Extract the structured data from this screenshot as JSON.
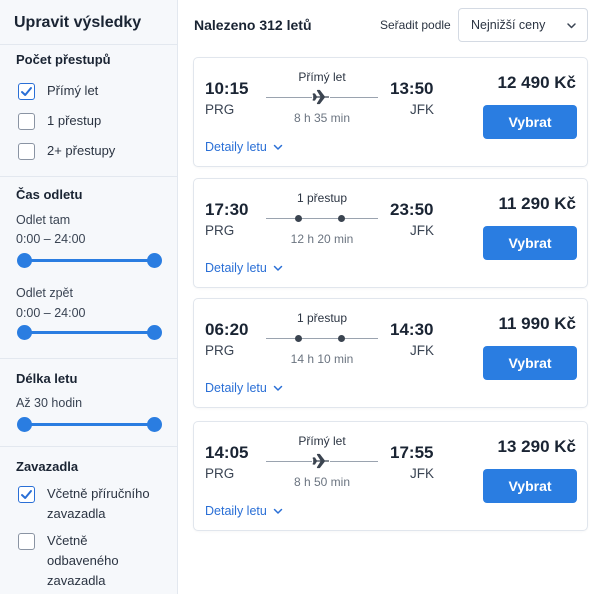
{
  "sidebar": {
    "title": "Upravit výsledky",
    "stops": {
      "heading": "Počet přestupů",
      "options": [
        {
          "label": "Přímý let",
          "checked": true
        },
        {
          "label": "1 přestup",
          "checked": false
        },
        {
          "label": "2+ přestupy",
          "checked": false
        }
      ]
    },
    "departure": {
      "heading": "Čas odletu",
      "outbound_label": "Odlet tam",
      "outbound_range": "0:00 – 24:00",
      "return_label": "Odlet zpět",
      "return_range": "0:00 – 24:00"
    },
    "duration": {
      "heading": "Délka letu",
      "value": "Až 30 hodin"
    },
    "baggage": {
      "heading": "Zavazadla",
      "options": [
        {
          "label": "Včetně příručního zavazadla",
          "checked": true
        },
        {
          "label": "Včetně odbaveného zavazadla",
          "checked": false
        }
      ]
    }
  },
  "header": {
    "results": "Nalezeno 312 letů",
    "sort_label": "Seřadit podle",
    "sort_value": "Nejnižší ceny"
  },
  "flights": [
    {
      "dep_time": "10:15",
      "dep_code": "PRG",
      "arr_time": "13:50",
      "arr_code": "JFK",
      "stops": "Přímý let",
      "duration": "8 h 35 min",
      "price": "12 490 Kč",
      "select": "Vybrat",
      "details": "Detaily letu",
      "direct": true
    },
    {
      "dep_time": "17:30",
      "dep_code": "PRG",
      "arr_time": "23:50",
      "arr_code": "JFK",
      "stops": "1 přestup",
      "duration": "12 h 20 min",
      "price": "11 290 Kč",
      "select": "Vybrat",
      "details": "Detaily letu",
      "direct": false
    },
    {
      "dep_time": "06:20",
      "dep_code": "PRG",
      "arr_time": "14:30",
      "arr_code": "JFK",
      "stops": "1 přestup",
      "duration": "14 h 10 min",
      "price": "11 990 Kč",
      "select": "Vybrat",
      "details": "Detaily letu",
      "direct": false
    },
    {
      "dep_time": "14:05",
      "dep_code": "PRG",
      "arr_time": "17:55",
      "arr_code": "JFK",
      "stops": "Přímý let",
      "duration": "8 h 50 min",
      "price": "13 290 Kč",
      "select": "Vybrat",
      "details": "Detaily letu",
      "direct": true
    }
  ],
  "colors": {
    "accent": "#2a7de1",
    "link": "#2a6fd6"
  },
  "icons": {
    "check": "check-icon",
    "plane": "plane-icon",
    "chevron": "chevron-down-icon"
  }
}
